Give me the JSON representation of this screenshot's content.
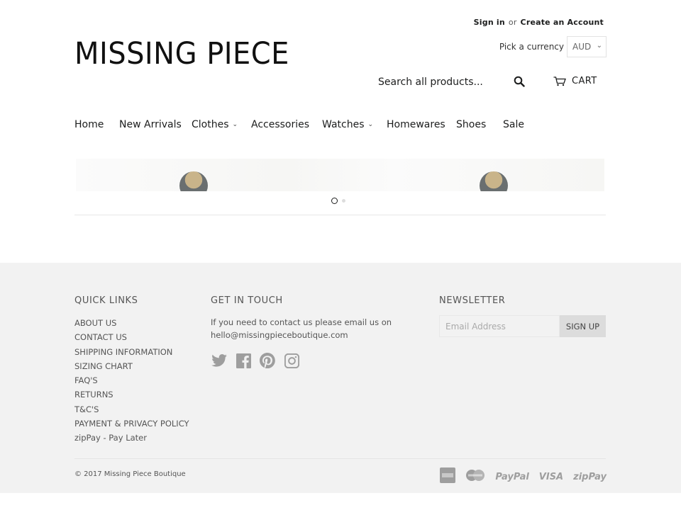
{
  "header": {
    "sign_in": "Sign in",
    "or": "or",
    "create_account": "Create an Account",
    "logo": "MISSING PIECE",
    "currency_label": "Pick a currency",
    "currency_value": "AUD",
    "search_placeholder": "Search all products...",
    "cart_label": "CART"
  },
  "nav": {
    "items": [
      {
        "label": "Home"
      },
      {
        "label": "New Arrivals"
      },
      {
        "label": "Clothes",
        "dropdown": true
      },
      {
        "label": "Accessories"
      },
      {
        "label": "Watches",
        "dropdown": true
      },
      {
        "label": "Homewares"
      },
      {
        "label": "Shoes"
      },
      {
        "label": "Sale"
      }
    ]
  },
  "slideshow": {
    "dots": [
      {
        "active": true
      },
      {
        "active": false
      }
    ]
  },
  "footer": {
    "quick_links": {
      "title": "QUICK LINKS",
      "links": [
        "ABOUT US",
        "CONTACT US",
        "SHIPPING INFORMATION",
        "SIZING CHART",
        "FAQ'S",
        "RETURNS",
        "T&C'S",
        "PAYMENT & PRIVACY POLICY",
        "zipPay - Pay Later"
      ]
    },
    "get_in_touch": {
      "title": "GET IN TOUCH",
      "text": "If you need to contact us please email us on hello@missingpieceboutique.com",
      "social": [
        "twitter-icon",
        "facebook-icon",
        "pinterest-icon",
        "instagram-icon"
      ]
    },
    "newsletter": {
      "title": "NEWSLETTER",
      "placeholder": "Email Address",
      "button": "SIGN UP"
    },
    "copyright": "© 2017 Missing Piece Boutique",
    "payments": {
      "paypal": "PayPal",
      "visa": "VISA",
      "zippay": "zipPay"
    }
  },
  "colors": {
    "text": "#1c1d1d",
    "footer_bg": "#f2f2f2",
    "footer_text": "#555555",
    "payment_icons": "#9e9e9e"
  }
}
